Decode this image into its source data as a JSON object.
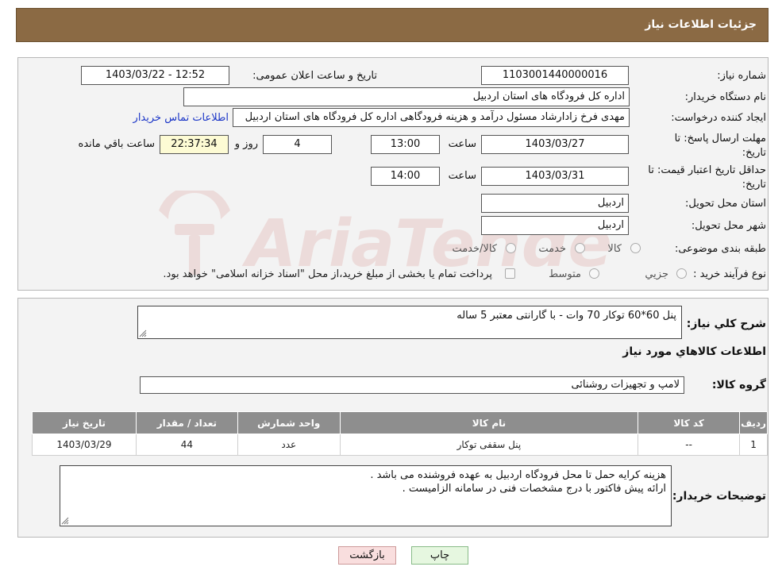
{
  "header": {
    "title": "جزئیات اطلاعات نیاز"
  },
  "form": {
    "need_number_label": "شماره نیاز:",
    "need_number": "1103001440000016",
    "announce_label": "تاریخ و ساعت اعلان عمومی:",
    "announce_value": "1403/03/22 - 12:52",
    "buyer_org_label": "نام دستگاه خریدار:",
    "buyer_org": "اداره کل فرودگاه های استان اردبیل",
    "creator_label": "ایجاد کننده درخواست:",
    "creator": "مهدی فرخ زادارشاد مسئول درآمد و هزینه فرودگاهی اداره کل فرودگاه های استان اردبیل",
    "contact_link": "اطلاعات تماس خریدار",
    "deadline_label_1": "مهلت ارسال پاسخ: تا",
    "deadline_label_2": "تاریخ:",
    "deadline_date": "1403/03/27",
    "time_label": "ساعت",
    "deadline_time": "13:00",
    "days_value": "4",
    "days_label": "روز و",
    "remaining_time": "22:37:34",
    "remaining_label": "ساعت باقي مانده",
    "validity_label_1": "حداقل تاریخ اعتبار قیمت: تا",
    "validity_label_2": "تاریخ:",
    "validity_date": "1403/03/31",
    "validity_time": "14:00",
    "province_label": "استان محل تحویل:",
    "province": "اردبیل",
    "city_label": "شهر محل تحویل:",
    "city": "اردبیل",
    "category_label": "طبقه بندی موضوعی:",
    "category_options": [
      "کالا",
      "خدمت",
      "کالا/خدمت"
    ],
    "purchase_type_label": "نوع فرآیند خرید :",
    "purchase_options": [
      "جزیي",
      "متوسط"
    ],
    "purchase_note": "پرداخت تمام یا بخشی از مبلغ خرید،از محل \"اسناد خزانه اسلامی\" خواهد بود."
  },
  "details": {
    "summary_label": "شرح کلي نياز:",
    "summary": "پنل 60*60 توکار 70 وات - با گارانتی معتبر 5 ساله",
    "goods_info_title": "اطلاعات کالاهاي مورد نياز",
    "goods_group_label": "گروه کالا:",
    "goods_group": "لامپ و تجهیزات روشنائی",
    "table": {
      "headers": [
        "ردیف",
        "کد کالا",
        "نام کالا",
        "واحد شمارش",
        "تعداد / مقدار",
        "تاریخ نیاز"
      ],
      "rows": [
        [
          "1",
          "--",
          "پنل سقفی توکار",
          "عدد",
          "44",
          "1403/03/29"
        ]
      ]
    },
    "buyer_notes_label": "توضیحات خریدار:",
    "buyer_notes_line1": "هزینه کرایه حمل تا محل فرودگاه اردبیل به عهده فروشنده می باشد .",
    "buyer_notes_line2": "ارائه پیش فاکتور با درج مشخصات فنی در سامانه الزامیست ."
  },
  "buttons": {
    "print": "چاپ",
    "back": "بازگشت"
  },
  "watermark": {
    "text": "AriaTender.neT",
    "color": "#c0392b"
  },
  "colors": {
    "header_bg": "#8b6a44",
    "table_header_bg": "#8e8e8e",
    "link": "#1a35c7",
    "back_button_bg": "#f9dede",
    "print_button_bg": "#e6f7e0"
  }
}
